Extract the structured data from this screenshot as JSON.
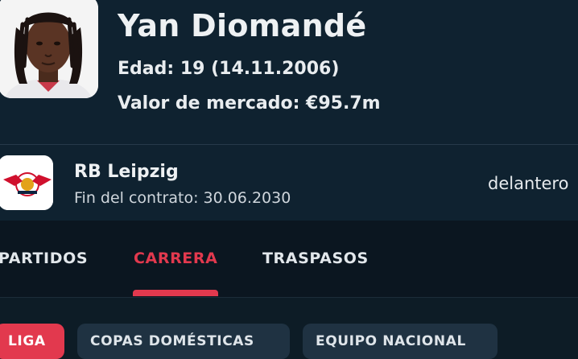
{
  "player": {
    "name": "Yan Diomandé",
    "age_line": "Edad: 19 (14.11.2006)",
    "market_value_line": "Valor de mercado: €95.7m"
  },
  "club": {
    "name": "RB Leipzig",
    "contract_line": "Fin del contrato: 30.06.2030",
    "position": "delantero",
    "logo_icon": "rb-leipzig-crest"
  },
  "tabs": [
    {
      "label": "PARTIDOS",
      "active": false
    },
    {
      "label": "CARRERA",
      "active": true
    },
    {
      "label": "TRASPASOS",
      "active": false
    }
  ],
  "chips": [
    {
      "label": "LIGA",
      "active": true
    },
    {
      "label": "COPAS DOMÉSTICAS",
      "active": false
    },
    {
      "label": "EQUIPO NACIONAL",
      "active": false
    }
  ],
  "colors": {
    "accent": "#e2394e",
    "background": "#0d1c26",
    "header": "#0f2230",
    "chip": "#1f3242"
  }
}
